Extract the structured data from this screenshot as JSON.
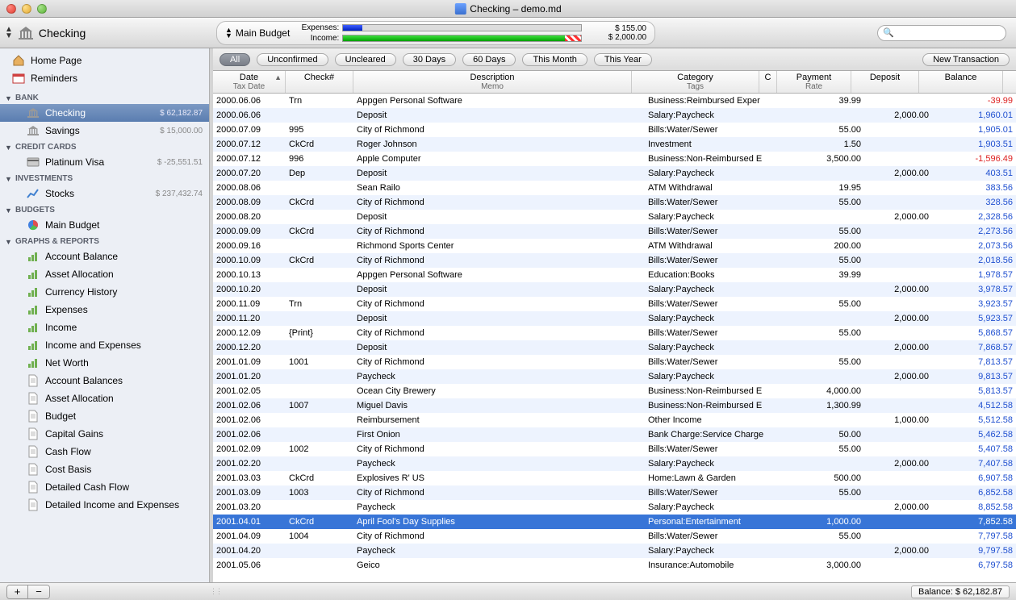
{
  "window": {
    "title": "Checking – demo.md"
  },
  "toolbar": {
    "account_name": "Checking",
    "budget_name": "Main Budget",
    "expenses_label": "Expenses:",
    "income_label": "Income:",
    "expenses_amount": "$ 155.00",
    "income_amount": "$ 2,000.00",
    "expenses_pct": 8,
    "income_pct": 100
  },
  "sidebar": {
    "home": "Home Page",
    "reminders": "Reminders",
    "sections": [
      {
        "name": "BANK",
        "items": [
          {
            "label": "Checking",
            "amount": "$ 62,182.87",
            "selected": true,
            "icon": "bank"
          },
          {
            "label": "Savings",
            "amount": "$ 15,000.00",
            "icon": "bank"
          }
        ]
      },
      {
        "name": "CREDIT CARDS",
        "items": [
          {
            "label": "Platinum Visa",
            "amount": "$ -25,551.51",
            "icon": "card"
          }
        ]
      },
      {
        "name": "INVESTMENTS",
        "items": [
          {
            "label": "Stocks",
            "amount": "$ 237,432.74",
            "icon": "stock"
          }
        ]
      },
      {
        "name": "BUDGETS",
        "items": [
          {
            "label": "Main Budget",
            "icon": "pie"
          }
        ]
      },
      {
        "name": "GRAPHS & REPORTS",
        "items": [
          {
            "label": "Account Balance",
            "icon": "chart"
          },
          {
            "label": "Asset Allocation",
            "icon": "chart"
          },
          {
            "label": "Currency History",
            "icon": "chart"
          },
          {
            "label": "Expenses",
            "icon": "chart"
          },
          {
            "label": "Income",
            "icon": "chart"
          },
          {
            "label": "Income and Expenses",
            "icon": "chart"
          },
          {
            "label": "Net Worth",
            "icon": "chart"
          },
          {
            "label": "Account Balances",
            "icon": "doc"
          },
          {
            "label": "Asset Allocation",
            "icon": "doc"
          },
          {
            "label": "Budget",
            "icon": "doc"
          },
          {
            "label": "Capital Gains",
            "icon": "doc"
          },
          {
            "label": "Cash Flow",
            "icon": "doc"
          },
          {
            "label": "Cost Basis",
            "icon": "doc"
          },
          {
            "label": "Detailed Cash Flow",
            "icon": "doc"
          },
          {
            "label": "Detailed Income and Expenses",
            "icon": "doc"
          }
        ]
      }
    ]
  },
  "filters": {
    "pills": [
      "All",
      "Unconfirmed",
      "Uncleared",
      "30 Days",
      "60 Days",
      "This Month",
      "This Year"
    ],
    "active": "All",
    "new_transaction": "New Transaction"
  },
  "columns": {
    "date": "Date",
    "tax_date": "Tax Date",
    "check": "Check#",
    "desc": "Description",
    "memo": "Memo",
    "cat": "Category",
    "tags": "Tags",
    "c": "C",
    "payment": "Payment",
    "rate": "Rate",
    "deposit": "Deposit",
    "balance": "Balance"
  },
  "transactions": [
    {
      "date": "2000.06.06",
      "check": "Trn",
      "desc": "Appgen Personal Software",
      "cat": "Business:Reimbursed Exper",
      "payment": "39.99",
      "deposit": "",
      "balance": "-39.99",
      "neg": true
    },
    {
      "date": "2000.06.06",
      "check": "",
      "desc": "Deposit",
      "cat": "Salary:Paycheck",
      "payment": "",
      "deposit": "2,000.00",
      "balance": "1,960.01"
    },
    {
      "date": "2000.07.09",
      "check": "995",
      "desc": "City of Richmond",
      "cat": "Bills:Water/Sewer",
      "payment": "55.00",
      "deposit": "",
      "balance": "1,905.01"
    },
    {
      "date": "2000.07.12",
      "check": "CkCrd",
      "desc": "Roger Johnson",
      "cat": "Investment",
      "payment": "1.50",
      "deposit": "",
      "balance": "1,903.51"
    },
    {
      "date": "2000.07.12",
      "check": "996",
      "desc": "Apple Computer",
      "cat": "Business:Non-Reimbursed E",
      "payment": "3,500.00",
      "deposit": "",
      "balance": "-1,596.49",
      "neg": true
    },
    {
      "date": "2000.07.20",
      "check": "Dep",
      "desc": "Deposit",
      "cat": "Salary:Paycheck",
      "payment": "",
      "deposit": "2,000.00",
      "balance": "403.51"
    },
    {
      "date": "2000.08.06",
      "check": "",
      "desc": "Sean Railo",
      "cat": "ATM Withdrawal",
      "payment": "19.95",
      "deposit": "",
      "balance": "383.56"
    },
    {
      "date": "2000.08.09",
      "check": "CkCrd",
      "desc": "City of Richmond",
      "cat": "Bills:Water/Sewer",
      "payment": "55.00",
      "deposit": "",
      "balance": "328.56"
    },
    {
      "date": "2000.08.20",
      "check": "",
      "desc": "Deposit",
      "cat": "Salary:Paycheck",
      "payment": "",
      "deposit": "2,000.00",
      "balance": "2,328.56"
    },
    {
      "date": "2000.09.09",
      "check": "CkCrd",
      "desc": "City of Richmond",
      "cat": "Bills:Water/Sewer",
      "payment": "55.00",
      "deposit": "",
      "balance": "2,273.56"
    },
    {
      "date": "2000.09.16",
      "check": "",
      "desc": "Richmond Sports Center",
      "cat": "ATM Withdrawal",
      "payment": "200.00",
      "deposit": "",
      "balance": "2,073.56"
    },
    {
      "date": "2000.10.09",
      "check": "CkCrd",
      "desc": "City of Richmond",
      "cat": "Bills:Water/Sewer",
      "payment": "55.00",
      "deposit": "",
      "balance": "2,018.56"
    },
    {
      "date": "2000.10.13",
      "check": "",
      "desc": "Appgen Personal Software",
      "cat": "Education:Books",
      "payment": "39.99",
      "deposit": "",
      "balance": "1,978.57"
    },
    {
      "date": "2000.10.20",
      "check": "",
      "desc": "Deposit",
      "cat": "Salary:Paycheck",
      "payment": "",
      "deposit": "2,000.00",
      "balance": "3,978.57"
    },
    {
      "date": "2000.11.09",
      "check": "Trn",
      "desc": "City of Richmond",
      "cat": "Bills:Water/Sewer",
      "payment": "55.00",
      "deposit": "",
      "balance": "3,923.57"
    },
    {
      "date": "2000.11.20",
      "check": "",
      "desc": "Deposit",
      "cat": "Salary:Paycheck",
      "payment": "",
      "deposit": "2,000.00",
      "balance": "5,923.57"
    },
    {
      "date": "2000.12.09",
      "check": "{Print}",
      "desc": "City of Richmond",
      "cat": "Bills:Water/Sewer",
      "payment": "55.00",
      "deposit": "",
      "balance": "5,868.57"
    },
    {
      "date": "2000.12.20",
      "check": "",
      "desc": "Deposit",
      "cat": "Salary:Paycheck",
      "payment": "",
      "deposit": "2,000.00",
      "balance": "7,868.57"
    },
    {
      "date": "2001.01.09",
      "check": "1001",
      "desc": "City of Richmond",
      "cat": "Bills:Water/Sewer",
      "payment": "55.00",
      "deposit": "",
      "balance": "7,813.57"
    },
    {
      "date": "2001.01.20",
      "check": "",
      "desc": "Paycheck",
      "cat": "Salary:Paycheck",
      "payment": "",
      "deposit": "2,000.00",
      "balance": "9,813.57"
    },
    {
      "date": "2001.02.05",
      "check": "",
      "desc": "Ocean City Brewery",
      "cat": "Business:Non-Reimbursed E",
      "payment": "4,000.00",
      "deposit": "",
      "balance": "5,813.57"
    },
    {
      "date": "2001.02.06",
      "check": "1007",
      "desc": "Miguel Davis",
      "cat": "Business:Non-Reimbursed E",
      "payment": "1,300.99",
      "deposit": "",
      "balance": "4,512.58"
    },
    {
      "date": "2001.02.06",
      "check": "",
      "desc": "Reimbursement",
      "cat": "Other Income",
      "payment": "",
      "deposit": "1,000.00",
      "balance": "5,512.58"
    },
    {
      "date": "2001.02.06",
      "check": "",
      "desc": "First Onion",
      "cat": "Bank Charge:Service Charge",
      "payment": "50.00",
      "deposit": "",
      "balance": "5,462.58"
    },
    {
      "date": "2001.02.09",
      "check": "1002",
      "desc": "City of Richmond",
      "cat": "Bills:Water/Sewer",
      "payment": "55.00",
      "deposit": "",
      "balance": "5,407.58"
    },
    {
      "date": "2001.02.20",
      "check": "",
      "desc": "Paycheck",
      "cat": "Salary:Paycheck",
      "payment": "",
      "deposit": "2,000.00",
      "balance": "7,407.58"
    },
    {
      "date": "2001.03.03",
      "check": "CkCrd",
      "desc": "Explosives R' US",
      "cat": "Home:Lawn & Garden",
      "payment": "500.00",
      "deposit": "",
      "balance": "6,907.58"
    },
    {
      "date": "2001.03.09",
      "check": "1003",
      "desc": "City of Richmond",
      "cat": "Bills:Water/Sewer",
      "payment": "55.00",
      "deposit": "",
      "balance": "6,852.58"
    },
    {
      "date": "2001.03.20",
      "check": "",
      "desc": "Paycheck",
      "cat": "Salary:Paycheck",
      "payment": "",
      "deposit": "2,000.00",
      "balance": "8,852.58"
    },
    {
      "date": "2001.04.01",
      "check": "CkCrd",
      "desc": "April Fool's Day Supplies",
      "cat": "Personal:Entertainment",
      "payment": "1,000.00",
      "deposit": "",
      "balance": "7,852.58",
      "selected": true
    },
    {
      "date": "2001.04.09",
      "check": "1004",
      "desc": "City of Richmond",
      "cat": "Bills:Water/Sewer",
      "payment": "55.00",
      "deposit": "",
      "balance": "7,797.58"
    },
    {
      "date": "2001.04.20",
      "check": "",
      "desc": "Paycheck",
      "cat": "Salary:Paycheck",
      "payment": "",
      "deposit": "2,000.00",
      "balance": "9,797.58"
    },
    {
      "date": "2001.05.06",
      "check": "",
      "desc": "Geico",
      "cat": "Insurance:Automobile",
      "payment": "3,000.00",
      "deposit": "",
      "balance": "6,797.58"
    }
  ],
  "statusbar": {
    "balance_label": "Balance: $ 62,182.87"
  }
}
